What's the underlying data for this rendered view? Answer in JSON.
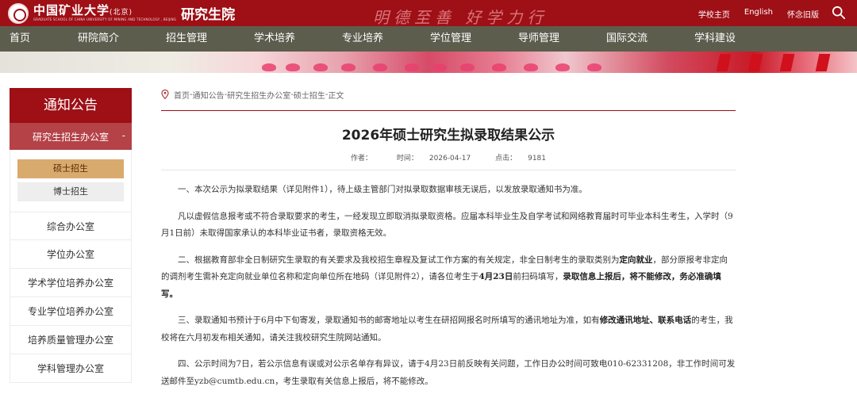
{
  "header": {
    "logo_cn": "中国矿业大学",
    "logo_cn_small": "(北京)",
    "logo_en": "GRADUATE SCHOOL OF CHINA UNIVERSITY OF MINING AND TECHNOLOGY , BEIJING",
    "logo_grad": "研究生院",
    "motto": "明德至善 好学力行",
    "links": [
      "学校主页",
      "English",
      "怀念旧版"
    ],
    "search_icon": "search-icon",
    "brand_color": "#9e0f16"
  },
  "nav": {
    "items": [
      "首页",
      "研院简介",
      "招生管理",
      "学术培养",
      "专业培养",
      "学位管理",
      "导师管理",
      "国际交流",
      "学科建设"
    ]
  },
  "sidebar": {
    "title": "通知公告",
    "current": "研究生招生办公室",
    "current_toggle": "-",
    "subitems": [
      "硕士招生",
      "博士招生"
    ],
    "items": [
      "综合办公室",
      "学位办公室",
      "学术学位培养办公室",
      "专业学位培养办公室",
      "培养质量管理办公室",
      "学科管理办公室"
    ]
  },
  "breadcrumb": {
    "items": [
      "首页",
      "通知公告",
      "研究生招生办公室",
      "硕士招生",
      "正文"
    ],
    "separator": " - "
  },
  "article": {
    "title": "2026年硕士研究生拟录取结果公示",
    "meta": {
      "author_label": "作者：",
      "time_label": "时间：",
      "time": "2026-04-17",
      "views_label": "点击：",
      "views": "9181"
    },
    "p1": "一、本次公示为拟录取结果（详见附件1），待上级主管部门对拟录取数据审核无误后，以发放录取通知书为准。",
    "p2": "凡以虚假信息报考或不符合录取要求的考生，一经发现立即取消拟录取资格。应届本科毕业生及自学考试和网络教育届时可毕业本科生考生，入学时（9月1日前）未取得国家承认的本科毕业证书者，录取资格无效。",
    "p3_a": "二、根据教育部非全日制研究生录取的有关要求及我校招生章程及复试工作方案的有关规定，非全日制考生的录取类别为",
    "p3_b": "定向就业",
    "p3_c": "，部分原报考非定向的调剂考生需补充定向就业单位名称和定向单位所在地码（详见附件2），请各位考生于",
    "p3_d": "4月23日",
    "p3_e": "前扫码填写，",
    "p3_f": "录取信息上报后，将不能修改，务必准确填写。",
    "p4_a": "三、录取通知书预计于6月中下旬寄发，录取通知书的邮寄地址以考生在研招网报名时所填写的通讯地址为准，如有",
    "p4_b": "修改通讯地址、联系电话",
    "p4_c": "的考生，我校将在六月初发布相关通知，请关注我校研究生院网站通知。",
    "p5": "四、公示时间为7日，若公示信息有误或对公示名单存有异议，请于4月23日前反映有关问题，工作日办公时间可致电010-62331208，非工作时间可发送邮件至yzb@cumtb.edu.cn，考生录取有关信息上报后，将不能修改。"
  }
}
